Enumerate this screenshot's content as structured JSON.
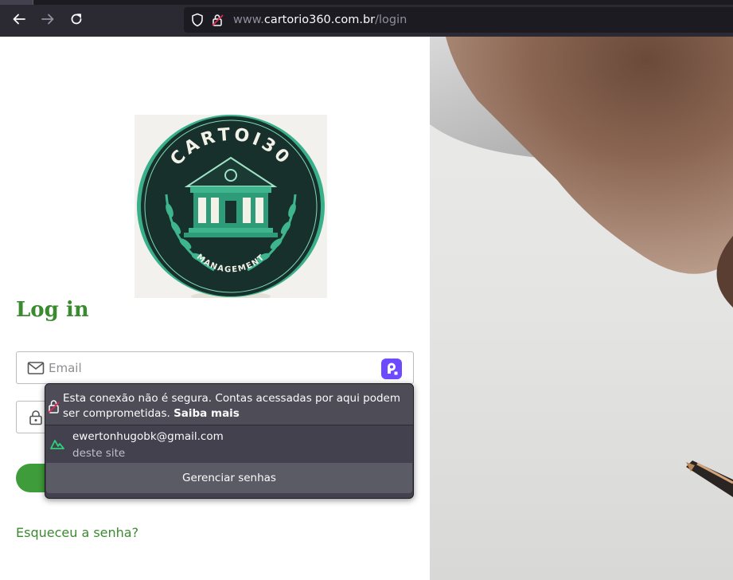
{
  "browser": {
    "url_prefix": "www.",
    "url_host": "cartorio360.com.br",
    "url_path": "/login"
  },
  "logo": {
    "brand_text": "CARTOI30",
    "sub_text": "MANAGEMENT"
  },
  "page": {
    "title": "Log in",
    "email_placeholder": "Email",
    "forgot_link": "Esqueceu a senha?"
  },
  "password_popup": {
    "warning_text": "Esta conexão não é segura. Contas acessadas por aqui podem ser comprometidas.",
    "learn_more": "Saiba mais",
    "saved_login": {
      "username": "ewertonhugobk@gmail.com",
      "origin": "deste site"
    },
    "manage_label": "Gerenciar senhas"
  },
  "colors": {
    "accent_green": "#3a8a2f",
    "button_green": "#3f9c3a",
    "toolbar_bg": "#2b2a33",
    "popup_bg": "#42414d"
  }
}
